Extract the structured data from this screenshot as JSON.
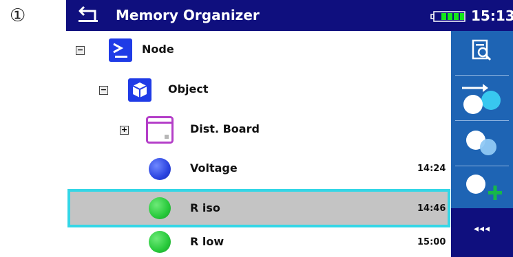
{
  "step_marker": "①",
  "header": {
    "title": "Memory Organizer",
    "time": "15:13",
    "battery_level": 1.0,
    "colors": {
      "bar": "#0f0f7e",
      "battery": "#12e81a"
    }
  },
  "tree": {
    "items": [
      {
        "label": "Node",
        "icon": "node-prompt-icon",
        "expander": "−",
        "level": 0
      },
      {
        "label": "Object",
        "icon": "object-cube-icon",
        "expander": "−",
        "level": 1
      },
      {
        "label": "Dist. Board",
        "icon": "dist-board-icon",
        "expander": "+",
        "level": 2
      },
      {
        "label": "Voltage",
        "time": "14:24",
        "status": "blue",
        "level": 3
      },
      {
        "label": "R iso",
        "time": "14:46",
        "status": "green",
        "level": 3,
        "selected": true
      },
      {
        "label": "R low",
        "time": "15:00",
        "status": "green",
        "level": 3
      }
    ],
    "status_colors": {
      "blue": "#2b44e0",
      "green": "#27c93a"
    }
  },
  "sidebar": {
    "buttons": [
      "view-results-icon",
      "go-to-test-icon",
      "clone-test-icon",
      "add-test-icon"
    ],
    "more_label": "◂◂◂",
    "colors": {
      "panel": "#1e64b4",
      "accent": "#38c8f0",
      "plus": "#16b84a"
    }
  }
}
